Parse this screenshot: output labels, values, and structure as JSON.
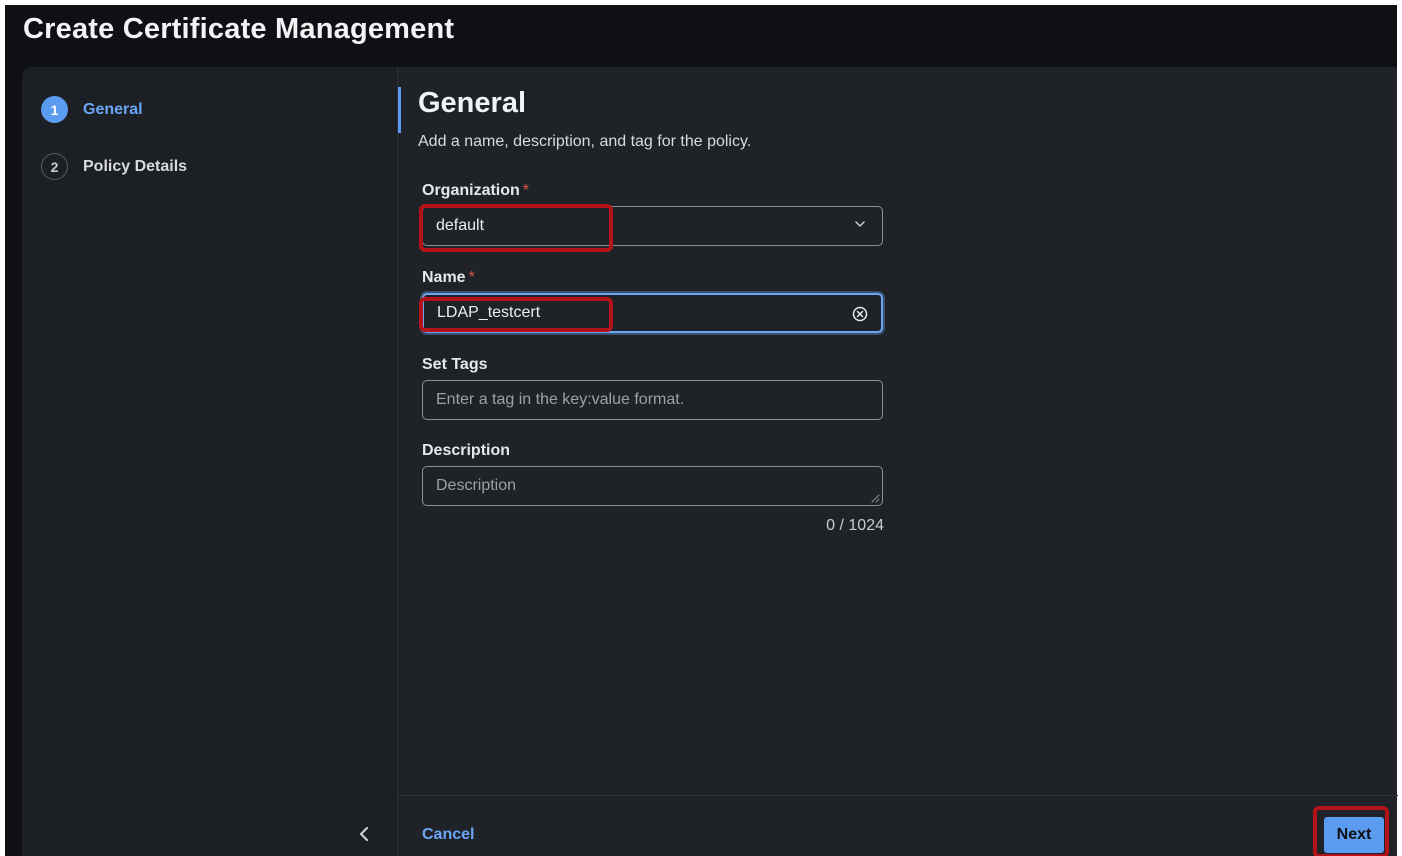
{
  "page": {
    "title": "Create Certificate Management"
  },
  "steps": [
    {
      "number": "1",
      "label": "General",
      "state": "active"
    },
    {
      "number": "2",
      "label": "Policy Details",
      "state": "inactive"
    }
  ],
  "section": {
    "title": "General",
    "description": "Add a name, description, and tag for the policy."
  },
  "form": {
    "organization": {
      "label": "Organization",
      "required_mark": "*",
      "value": "default"
    },
    "name": {
      "label": "Name",
      "required_mark": "*",
      "value": "LDAP_testcert"
    },
    "tags": {
      "label": "Set Tags",
      "placeholder": "Enter a tag in the key:value format."
    },
    "description": {
      "label": "Description",
      "placeholder": "Description",
      "counter": "0 / 1024"
    }
  },
  "footer": {
    "cancel_label": "Cancel",
    "next_label": "Next"
  },
  "icons": {
    "collapse": "chevron-left-icon",
    "dropdown": "chevron-down-icon",
    "clear": "clear-circle-icon",
    "resize": "resize-grip-icon"
  },
  "colors": {
    "accent": "#5b9bf0",
    "highlight": "#b3121a",
    "background": "#1f2328"
  }
}
